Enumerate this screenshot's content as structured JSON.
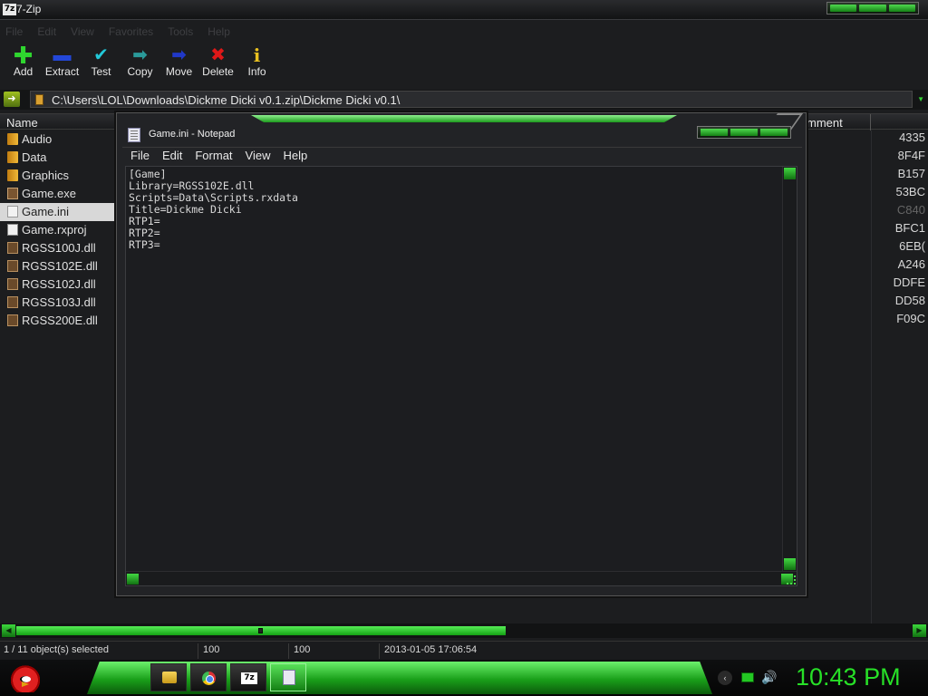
{
  "app": {
    "title": "7-Zip",
    "icon_text": "7z"
  },
  "menubar": [
    "File",
    "Edit",
    "View",
    "Favorites",
    "Tools",
    "Help"
  ],
  "toolbar": [
    {
      "label": "Add",
      "icon": "add-icon",
      "glyph": "✚"
    },
    {
      "label": "Extract",
      "icon": "extract-icon",
      "glyph": "▬"
    },
    {
      "label": "Test",
      "icon": "test-icon",
      "glyph": "✔"
    },
    {
      "label": "Copy",
      "icon": "copy-icon",
      "glyph": "➡"
    },
    {
      "label": "Move",
      "icon": "move-icon",
      "glyph": "➡"
    },
    {
      "label": "Delete",
      "icon": "delete-icon",
      "glyph": "✖"
    },
    {
      "label": "Info",
      "icon": "info-icon",
      "glyph": "i"
    }
  ],
  "address": {
    "path": "C:\\Users\\LOL\\Downloads\\Dickme Dicki v0.1.zip\\Dickme Dicki v0.1\\"
  },
  "columns": {
    "name": "Name",
    "comment": "mment"
  },
  "files": [
    {
      "name": "Audio",
      "type": "folder",
      "crc": "4335"
    },
    {
      "name": "Data",
      "type": "folder",
      "crc": "8F4F"
    },
    {
      "name": "Graphics",
      "type": "folder",
      "crc": "B157"
    },
    {
      "name": "Game.exe",
      "type": "exe",
      "crc": "53BC"
    },
    {
      "name": "Game.ini",
      "type": "ini",
      "crc": "C840",
      "selected": true
    },
    {
      "name": "Game.rxproj",
      "type": "file",
      "crc": "BFC1"
    },
    {
      "name": "RGSS100J.dll",
      "type": "dll",
      "crc": "6EB("
    },
    {
      "name": "RGSS102E.dll",
      "type": "dll",
      "crc": "A246"
    },
    {
      "name": "RGSS102J.dll",
      "type": "dll",
      "crc": "DDFE"
    },
    {
      "name": "RGSS103J.dll",
      "type": "dll",
      "crc": "DD58"
    },
    {
      "name": "RGSS200E.dll",
      "type": "dll",
      "crc": "F09C"
    }
  ],
  "status": {
    "selection": "1 / 11 object(s) selected",
    "size": "100",
    "packed": "100",
    "modified": "2013-01-05 17:06:54"
  },
  "notepad": {
    "title": "Game.ini - Notepad",
    "menu": [
      "File",
      "Edit",
      "Format",
      "View",
      "Help"
    ],
    "content": "[Game]\nLibrary=RGSS102E.dll\nScripts=Data\\Scripts.rxdata\nTitle=Dickme Dicki\nRTP1=\nRTP2=\nRTP3="
  },
  "taskbar": {
    "clock": "10:43 PM",
    "apps": [
      "folder-icon",
      "chrome-icon",
      "7zip-icon",
      "notepad-icon"
    ]
  },
  "colors": {
    "accent_green": "#27e027",
    "window_bg": "#1c1d1f"
  }
}
